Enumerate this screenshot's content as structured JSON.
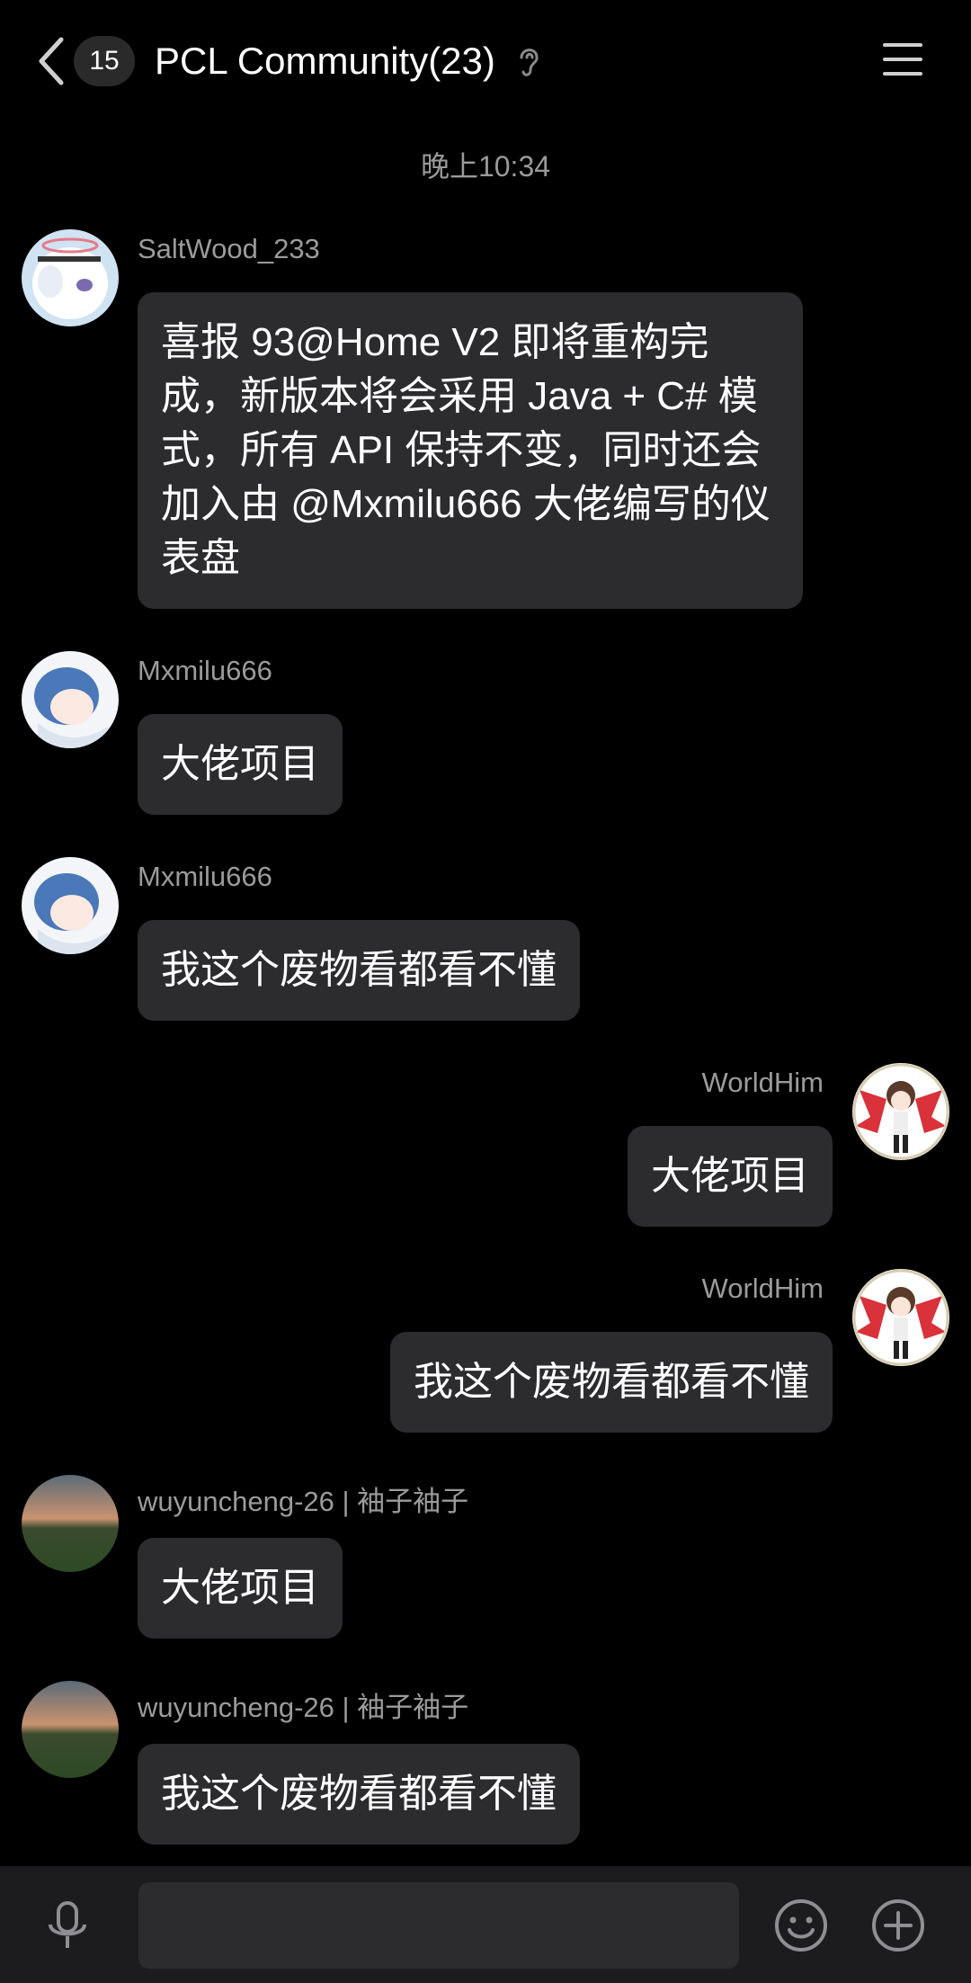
{
  "header": {
    "unread_count": "15",
    "title": "PCL Community(23)",
    "icons": [
      "back-arrow-icon",
      "ear-icon",
      "menu-icon"
    ]
  },
  "timestamp": "晚上10:34",
  "messages": [
    {
      "sender": "SaltWood_233",
      "side": "left",
      "text": "喜报 93@Home V2 即将重构完成，新版本将会采用 Java + C# 模式，所有 API 保持不变，同时还会加入由 @Mxmilu666 大佬编写的仪表盘"
    },
    {
      "sender": "Mxmilu666",
      "side": "left",
      "text": "大佬项目"
    },
    {
      "sender": "Mxmilu666",
      "side": "left",
      "text": "我这个废物看都看不懂"
    },
    {
      "sender": "WorldHim",
      "side": "right",
      "text": "大佬项目"
    },
    {
      "sender": "WorldHim",
      "side": "right",
      "text": "我这个废物看都看不懂"
    },
    {
      "sender": "wuyuncheng-26 | 袖子袖子",
      "side": "left",
      "text": "大佬项目"
    },
    {
      "sender": "wuyuncheng-26 | 袖子袖子",
      "side": "left",
      "text": "我这个废物看都看不懂"
    }
  ],
  "input_bar": {
    "value": "",
    "icons": [
      "microphone-icon",
      "emoji-icon",
      "plus-icon"
    ]
  }
}
